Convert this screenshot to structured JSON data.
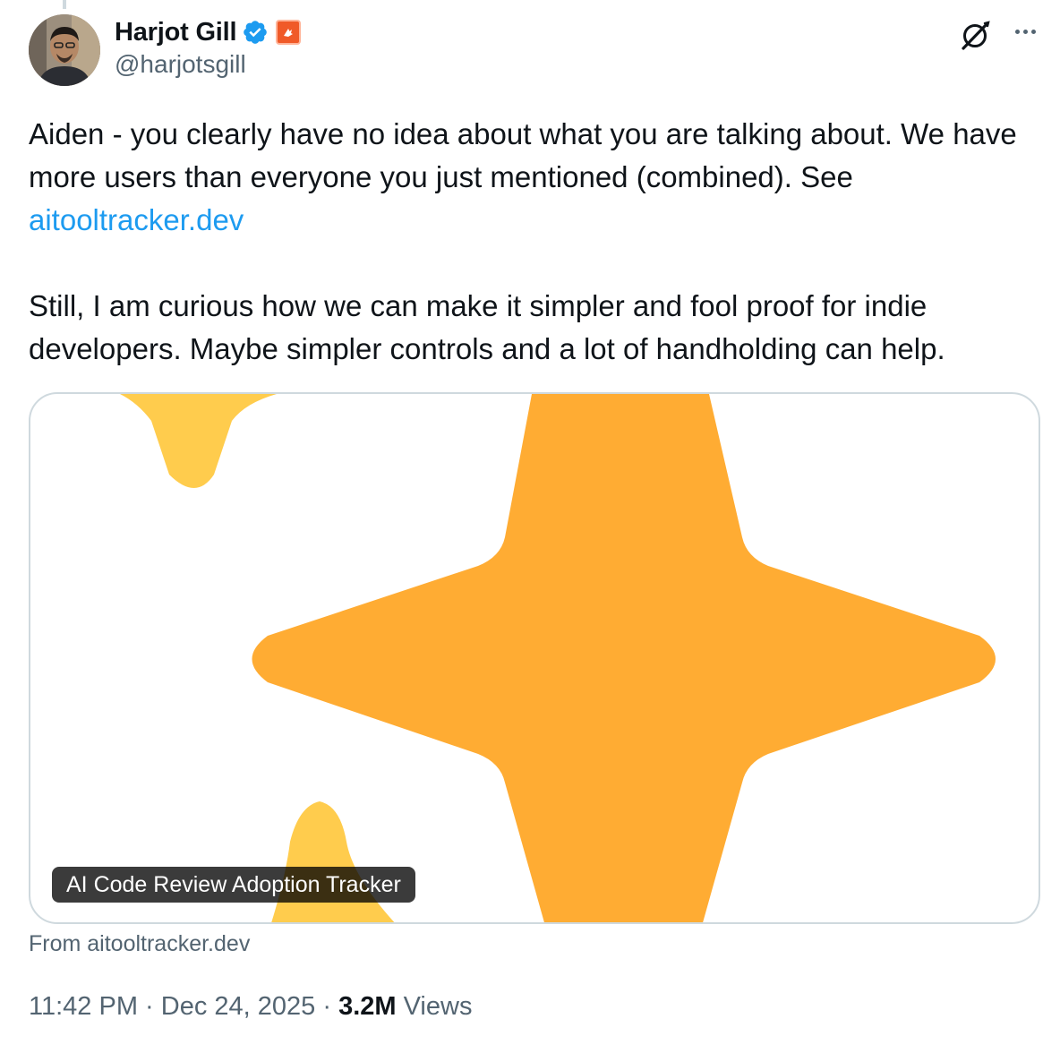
{
  "author": {
    "display_name": "Harjot Gill",
    "handle": "@harjotsgill",
    "verified": true
  },
  "icons": {
    "verified": "verified-badge-icon",
    "affiliate": "affiliate-badge-icon",
    "grok": "grok-icon",
    "more": "more-options-icon"
  },
  "tweet": {
    "paragraph1_text": "Aiden - you clearly have no idea about what you are talking about. We have more users than everyone you just mentioned (combined). See",
    "link_text": "aitooltracker.dev",
    "paragraph2_text": "Still, I am curious how we can make it simpler and fool proof for indie developers. Maybe simpler controls and a lot of handholding can help."
  },
  "card": {
    "title": "AI Code Review Adoption Tracker",
    "source": "From aitooltracker.dev"
  },
  "meta": {
    "time": "11:42 PM",
    "separator1": " · ",
    "date": "Dec 24, 2025",
    "separator2": " · ",
    "views_count": "3.2M",
    "views_label": "Views"
  },
  "colors": {
    "accent_link": "#1d9bf0",
    "verified_blue": "#1d9bf0",
    "star_primary": "#ffac33",
    "star_secondary": "#ffcc4d",
    "affiliate_orange": "#f05a28"
  }
}
